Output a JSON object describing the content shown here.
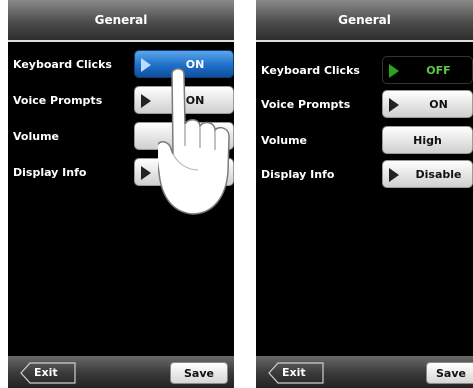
{
  "left": {
    "title": "General",
    "rows": [
      {
        "label": "Keyboard Clicks",
        "value": "ON"
      },
      {
        "label": "Voice Prompts",
        "value": "ON"
      },
      {
        "label": "Volume",
        "value": ""
      },
      {
        "label": "Display Info",
        "value": "D"
      }
    ],
    "exit_label": "Exit",
    "save_label": "Save"
  },
  "right": {
    "title": "General",
    "rows": [
      {
        "label": "Keyboard Clicks",
        "value": "OFF"
      },
      {
        "label": "Voice Prompts",
        "value": "ON"
      },
      {
        "label": "Volume",
        "value": "High"
      },
      {
        "label": "Display Info",
        "value": "Disable"
      }
    ],
    "exit_label": "Exit",
    "save_label": "Save"
  },
  "colors": {
    "active_blue": "#1e6fc8",
    "off_green": "#5cc94a"
  }
}
